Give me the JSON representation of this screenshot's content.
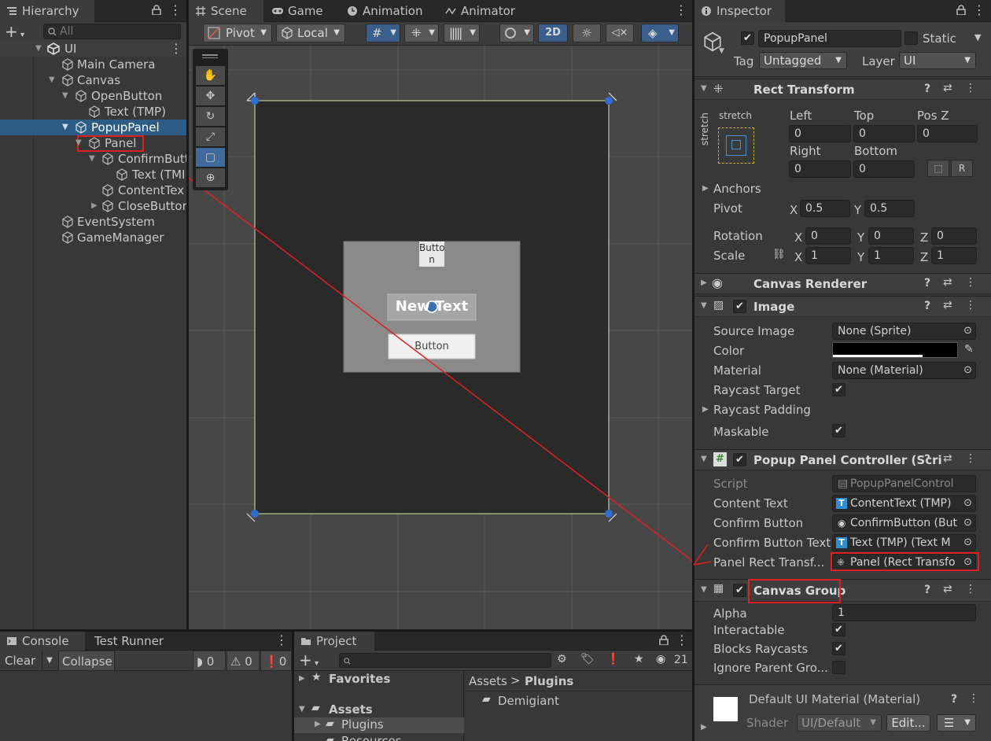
{
  "hierarchy": {
    "tab": "Hierarchy",
    "search_placeholder": "All",
    "items": [
      {
        "label": "UI"
      },
      {
        "label": "Main Camera"
      },
      {
        "label": "Canvas"
      },
      {
        "label": "OpenButton"
      },
      {
        "label": "Text (TMP)"
      },
      {
        "label": "PopupPanel"
      },
      {
        "label": "Panel"
      },
      {
        "label": "ConfirmButt"
      },
      {
        "label": "Text (TMI"
      },
      {
        "label": "ContentTex"
      },
      {
        "label": "CloseButtor"
      },
      {
        "label": "EventSystem"
      },
      {
        "label": "GameManager"
      }
    ]
  },
  "scene": {
    "tabs": [
      "Scene",
      "Game",
      "Animation",
      "Animator"
    ],
    "pivot": "Pivot",
    "local": "Local",
    "mode_2d": "2D",
    "button_top": "Butto\nn",
    "new_text": "New Text",
    "button_bottom": "Button"
  },
  "inspector": {
    "tab": "Inspector",
    "object_name": "PopupPanel",
    "static_label": "Static",
    "tag_label": "Tag",
    "tag_value": "Untagged",
    "layer_label": "Layer",
    "layer_value": "UI",
    "rect_transform": {
      "title": "Rect Transform",
      "stretch_top": "stretch",
      "stretch_side": "stretch",
      "left_label": "Left",
      "left": "0",
      "top_label": "Top",
      "top": "0",
      "posz_label": "Pos Z",
      "posz": "0",
      "right_label": "Right",
      "right": "0",
      "bottom_label": "Bottom",
      "bottom": "0",
      "anchors": "Anchors",
      "pivot_label": "Pivot",
      "pivot_x": "0.5",
      "pivot_y": "0.5",
      "rotation_label": "Rotation",
      "rot_x": "0",
      "rot_y": "0",
      "rot_z": "0",
      "scale_label": "Scale",
      "scale_x": "1",
      "scale_y": "1",
      "scale_z": "1",
      "x": "X",
      "y": "Y",
      "z": "Z"
    },
    "canvas_renderer": "Canvas Renderer",
    "image": {
      "title": "Image",
      "source_image_label": "Source Image",
      "source_image": "None (Sprite)",
      "color_label": "Color",
      "material_label": "Material",
      "material": "None (Material)",
      "raycast_target": "Raycast Target",
      "raycast_padding": "Raycast Padding",
      "maskable": "Maskable"
    },
    "popup_controller": {
      "title": "Popup Panel Controller (Scri",
      "script_label": "Script",
      "script": "PopupPanelControl",
      "content_text_label": "Content Text",
      "content_text": "ContentText (TMP)",
      "confirm_button_label": "Confirm Button",
      "confirm_button": "ConfirmButton (But",
      "confirm_button_text_label": "Confirm Button Text",
      "confirm_button_text": "Text (TMP) (Text M",
      "panel_rect_label": "Panel Rect Transf...",
      "panel_rect": "Panel (Rect Transfo"
    },
    "canvas_group": {
      "title": "Canvas Group",
      "alpha_label": "Alpha",
      "alpha": "1",
      "interactable": "Interactable",
      "blocks_raycasts": "Blocks Raycasts",
      "ignore_parent": "Ignore Parent Gro..."
    },
    "material": {
      "name": "Default UI Material (Material)",
      "shader_label": "Shader",
      "shader": "UI/Default",
      "edit": "Edit..."
    }
  },
  "console": {
    "tabs": [
      "Console",
      "Test Runner"
    ],
    "clear": "Clear",
    "collapse": "Collapse",
    "count_info": "0",
    "count_warn": "0",
    "count_err": "0"
  },
  "project": {
    "tab": "Project",
    "favorites": "Favorites",
    "assets": "Assets",
    "plugins": "Plugins",
    "resources": "Resources",
    "breadcrumb_assets": "Assets",
    "breadcrumb_plugins": "Plugins",
    "folder": "Demigiant",
    "hidden_count": "21"
  },
  "colors": {
    "accent": "#2c5d87",
    "annotation": "#e02020"
  }
}
